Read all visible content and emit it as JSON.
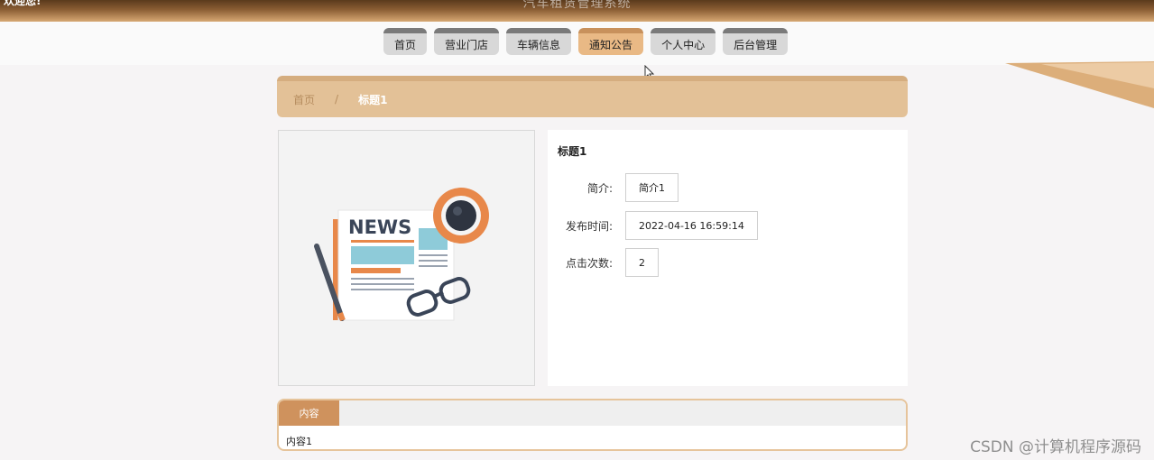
{
  "header": {
    "system_title": "汽车租赁管理系统",
    "corner_text": "欢迎您!"
  },
  "nav": {
    "items": [
      {
        "label": "首页"
      },
      {
        "label": "营业门店"
      },
      {
        "label": "车辆信息"
      },
      {
        "label": "通知公告",
        "active": true
      },
      {
        "label": "个人中心"
      },
      {
        "label": "后台管理"
      }
    ]
  },
  "breadcrumb": {
    "home": "首页",
    "separator": "/",
    "current": "标题1"
  },
  "image": {
    "icon": "news-illustration",
    "news_text": "NEWS"
  },
  "detail": {
    "title": "标题1",
    "fields": [
      {
        "label": "简介:",
        "value": "简介1"
      },
      {
        "label": "发布时间:",
        "value": "2022-04-16 16:59:14"
      },
      {
        "label": "点击次数:",
        "value": "2"
      }
    ]
  },
  "content": {
    "tab_label": "内容",
    "text": "内容1"
  },
  "watermark": "CSDN @计算机程序源码",
  "colors": {
    "accent": "#cf925d",
    "breadcrumb_bg": "#e3c197",
    "nav_active": "#e9b985"
  }
}
